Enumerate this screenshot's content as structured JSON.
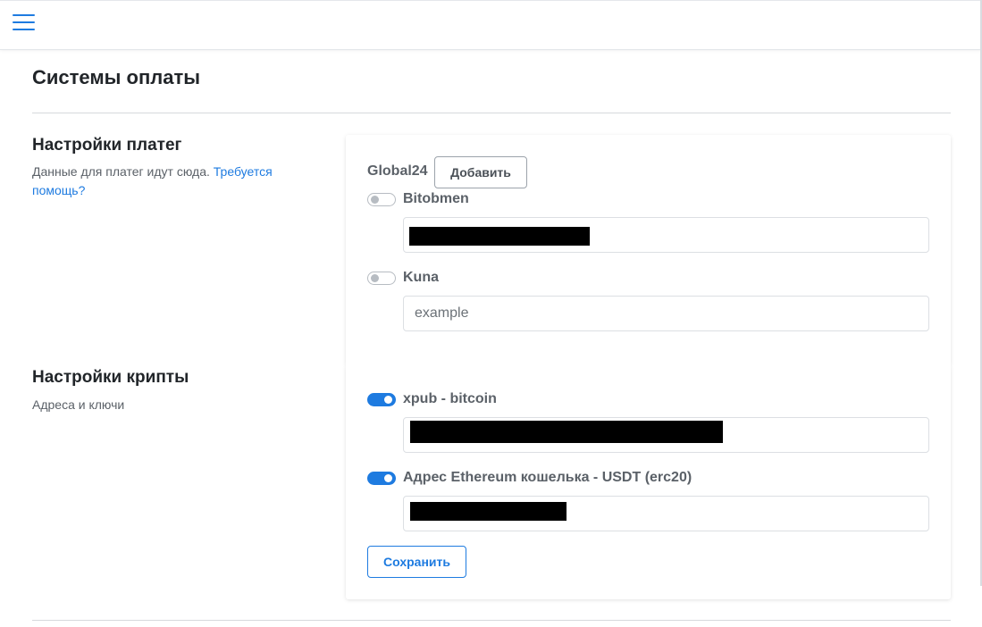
{
  "topbar": {
    "menu_icon": "hamburger-menu-icon",
    "accent_color": "#1e7be0"
  },
  "page": {
    "title": "Системы оплаты"
  },
  "payments_section": {
    "heading": "Настройки платег",
    "description": "Данные для платег идут сюда.",
    "help_link": "Требуется помощь?",
    "providers": [
      {
        "label": "Global24",
        "add_button": "Добавить"
      },
      {
        "label": "Bitobmen",
        "enabled": false,
        "value": "",
        "value_redacted": true
      },
      {
        "label": "Kuna",
        "enabled": false,
        "placeholder": "example"
      }
    ]
  },
  "crypto_section": {
    "heading": "Настройки крипты",
    "description": "Адреса и ключи",
    "items": [
      {
        "label": "xpub - bitcoin",
        "enabled": true,
        "value_redacted": true
      },
      {
        "label": "Адрес Ethereum кошелька - USDT (erc20)",
        "enabled": true,
        "value_redacted": true
      }
    ],
    "save_button": "Сохранить"
  },
  "colors": {
    "accent": "#1e7be0",
    "text": "#212529",
    "muted": "#5b6168",
    "toggle_off": "#b7bcc2"
  }
}
